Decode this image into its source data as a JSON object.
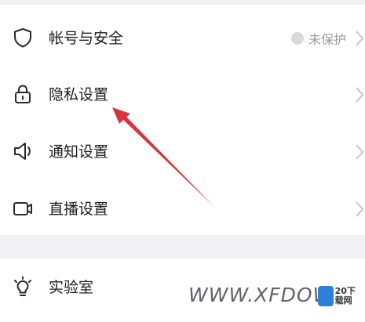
{
  "settings": {
    "items": [
      {
        "label": "帐号与安全",
        "icon": "shield-icon",
        "status": "未保护"
      },
      {
        "label": "隐私设置",
        "icon": "lock-icon"
      },
      {
        "label": "通知设置",
        "icon": "speaker-icon"
      },
      {
        "label": "直播设置",
        "icon": "video-camera-icon"
      }
    ],
    "lab": {
      "label": "实验室",
      "icon": "lightbulb-icon"
    }
  },
  "watermark": {
    "text": "WWW.XFDOW",
    "logo_text": "20下载网"
  },
  "colors": {
    "background": "#f2f2f4",
    "card": "#ffffff",
    "text": "#1d1d1f",
    "muted": "#9a9aa0",
    "arrow": "#d9353f"
  }
}
